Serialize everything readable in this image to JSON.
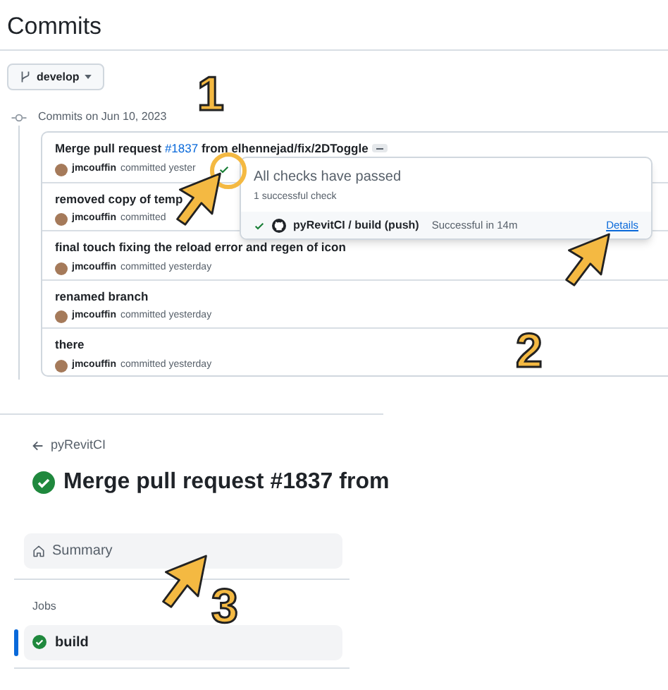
{
  "header": {
    "title": "Commits"
  },
  "branch_button": {
    "label": "develop"
  },
  "commit_group": {
    "date_label": "Commits on Jun 10, 2023"
  },
  "commits": [
    {
      "title": "Merge pull request **#1837** from elhennejad/fix/2DToggle",
      "author": "jmcouffin",
      "meta": "committed yester",
      "has_more": true,
      "checks_passed": true
    },
    {
      "title": "removed copy of temp",
      "author": "jmcouffin",
      "meta": "committed",
      "has_more": false,
      "checks_passed": false
    },
    {
      "title": "final touch fixing the reload error and regen of icon",
      "author": "jmcouffin",
      "meta": "committed yesterday",
      "has_more": false,
      "checks_passed": false
    },
    {
      "title": "renamed branch",
      "author": "jmcouffin",
      "meta": "committed yesterday",
      "has_more": false,
      "checks_passed": false
    },
    {
      "title": "there",
      "author": "jmcouffin",
      "meta": "committed yesterday",
      "has_more": false,
      "checks_passed": false
    }
  ],
  "checks_popup": {
    "title": "All checks have passed",
    "subtitle": "1 successful check",
    "check": {
      "name": "pyRevitCI / build (push)",
      "status": "Successful in 14m",
      "link": "Details"
    }
  },
  "run": {
    "back_label": "pyRevitCI",
    "title": "Merge pull request #1837 from",
    "summary": {
      "label": "Summary",
      "selected": false
    },
    "jobs_heading": "Jobs",
    "jobs": [
      {
        "name": "build",
        "selected": true
      }
    ]
  },
  "annotations": [
    {
      "kind": "number",
      "text": "1"
    },
    {
      "kind": "circle"
    },
    {
      "kind": "arrow"
    },
    {
      "kind": "arrow"
    },
    {
      "kind": "number",
      "text": "2"
    },
    {
      "kind": "arrow"
    },
    {
      "kind": "number",
      "text": "3"
    }
  ]
}
